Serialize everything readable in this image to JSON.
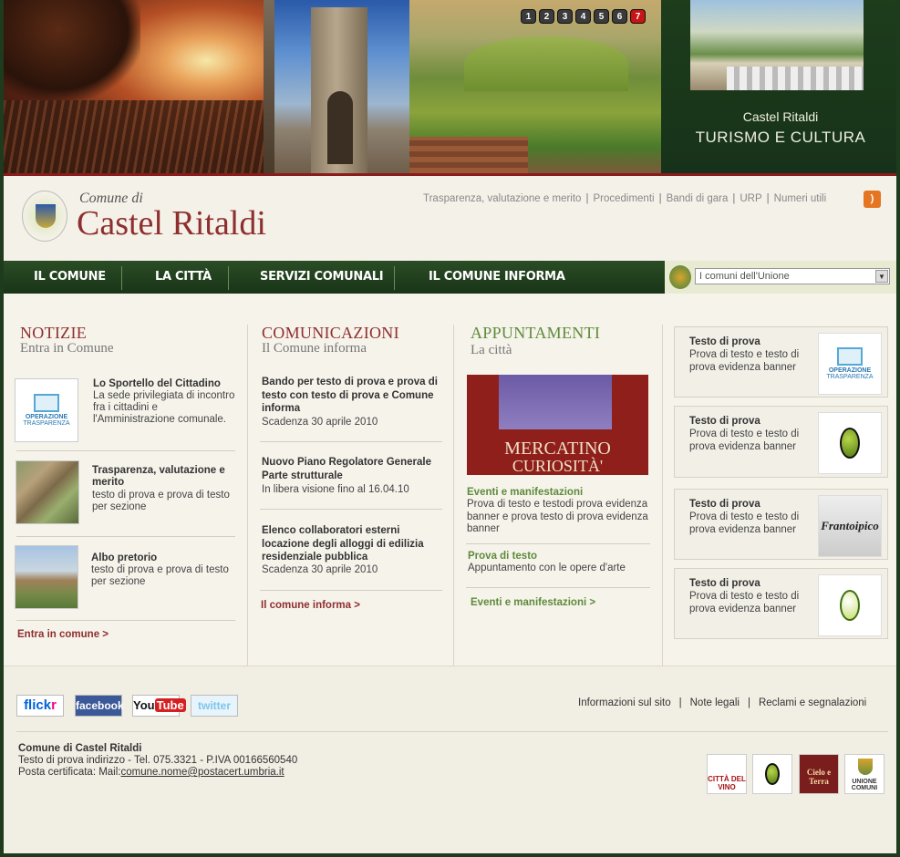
{
  "slideshow": {
    "buttons": [
      "1",
      "2",
      "3",
      "4",
      "5",
      "6",
      "7"
    ],
    "active": "7"
  },
  "tourism": {
    "line1": "Castel Ritaldi",
    "line2": "TURISMO E CULTURA"
  },
  "masthead": {
    "prefix": "Comune di",
    "name": "Castel Ritaldi"
  },
  "toplinks": [
    "Trasparenza, valutazione e merito",
    "Procedimenti",
    "Bandi di gara",
    "URP",
    "Numeri utili"
  ],
  "nav": {
    "items": [
      "IL COMUNE",
      "LA CITTÀ",
      "SERVIZI COMUNALI",
      "IL COMUNE INFORMA"
    ],
    "select_value": "I comuni dell'Unione"
  },
  "notizie": {
    "title": "NOTIZIE",
    "subtitle": "Entra in Comune",
    "items": [
      {
        "title": "Lo Sportello del Cittadino",
        "text": "La  sede privilegiata di incontro fra i cittadini e l'Amministrazione comunale."
      },
      {
        "title": "Trasparenza, valutazione e merito",
        "text": "testo di prova e prova di testo per sezione"
      },
      {
        "title": "Albo pretorio",
        "text": "testo di prova e prova di testo per sezione"
      }
    ],
    "thumb_logo": {
      "w1": "OPERAZIONE",
      "w2": "TRASPARENZA"
    },
    "more": "Entra in comune >"
  },
  "comunicazioni": {
    "title": "COMUNICAZIONI",
    "subtitle": "Il Comune informa",
    "items": [
      {
        "title": "Bando per testo di prova e prova di testo con testo di prova e Comune informa",
        "text": "Scadenza 30 aprile 2010"
      },
      {
        "title": "Nuovo Piano Regolatore Generale Parte strutturale",
        "text": "In libera visione fino al 16.04.10"
      },
      {
        "title": "Elenco collaboratori esterni locazione degli alloggi di edilizia residenziale pubblica",
        "text": "Scadenza 30 aprile 2010"
      }
    ],
    "more": "Il comune informa >"
  },
  "appuntamenti": {
    "title": "APPUNTAMENTI",
    "subtitle": "La città",
    "image_text": {
      "line1": "MERCATINO",
      "line2": "CURIOSITÀ'"
    },
    "items": [
      {
        "title": "Eventi e manifestazioni",
        "text": "Prova di testo e testodi prova evidenza banner  e prova  testo di prova evidenza banner"
      },
      {
        "title": "Prova di testo",
        "text": "Appuntamento con le opere d'arte"
      }
    ],
    "more": "Eventi e manifestazioni >"
  },
  "banners": [
    {
      "title": "Testo di prova",
      "text": "Prova di testo e testo di prova evidenza banner",
      "logo": "operazione-trasparenza"
    },
    {
      "title": "Testo di prova",
      "text": "Prova di testo e testo di prova evidenza banner",
      "logo": "olive"
    },
    {
      "title": "Testo di prova",
      "text": "Prova di testo e testo di prova evidenza banner",
      "logo": "frantoipico",
      "logo_text": "Frantoipico"
    },
    {
      "title": "Testo di prova",
      "text": "Prova di testo e testo di prova evidenza banner",
      "logo": "olive-2"
    }
  ],
  "social": {
    "flickr_a": "flick",
    "flickr_b": "r",
    "facebook": "facebook",
    "youtube_a": "You",
    "youtube_b": "Tube",
    "twitter": "twitter"
  },
  "footer_links": [
    "Informazioni sul sito",
    "Note legali",
    "Reclami e segnalazioni"
  ],
  "footer": {
    "name": "Comune di Castel Ritaldi",
    "address": "Testo di prova indirizzo  - Tel. 075.3321 - P.IVA 00166560540",
    "pec_label": "Posta certificata: Mail:",
    "pec_email": "comune.nome@postacert.umbria.it"
  },
  "partner_logos": {
    "vino": "CITTÀ DEL VINO",
    "terra": "Cielo e Terra",
    "unione": "UNIONE COMUNI"
  },
  "colors": {
    "brand_red": "#8e2f2f",
    "nav_green": "#1f3b1d",
    "accent_green": "#5e8b3b",
    "slide_active": "#c81414",
    "rss": "#e57521"
  }
}
